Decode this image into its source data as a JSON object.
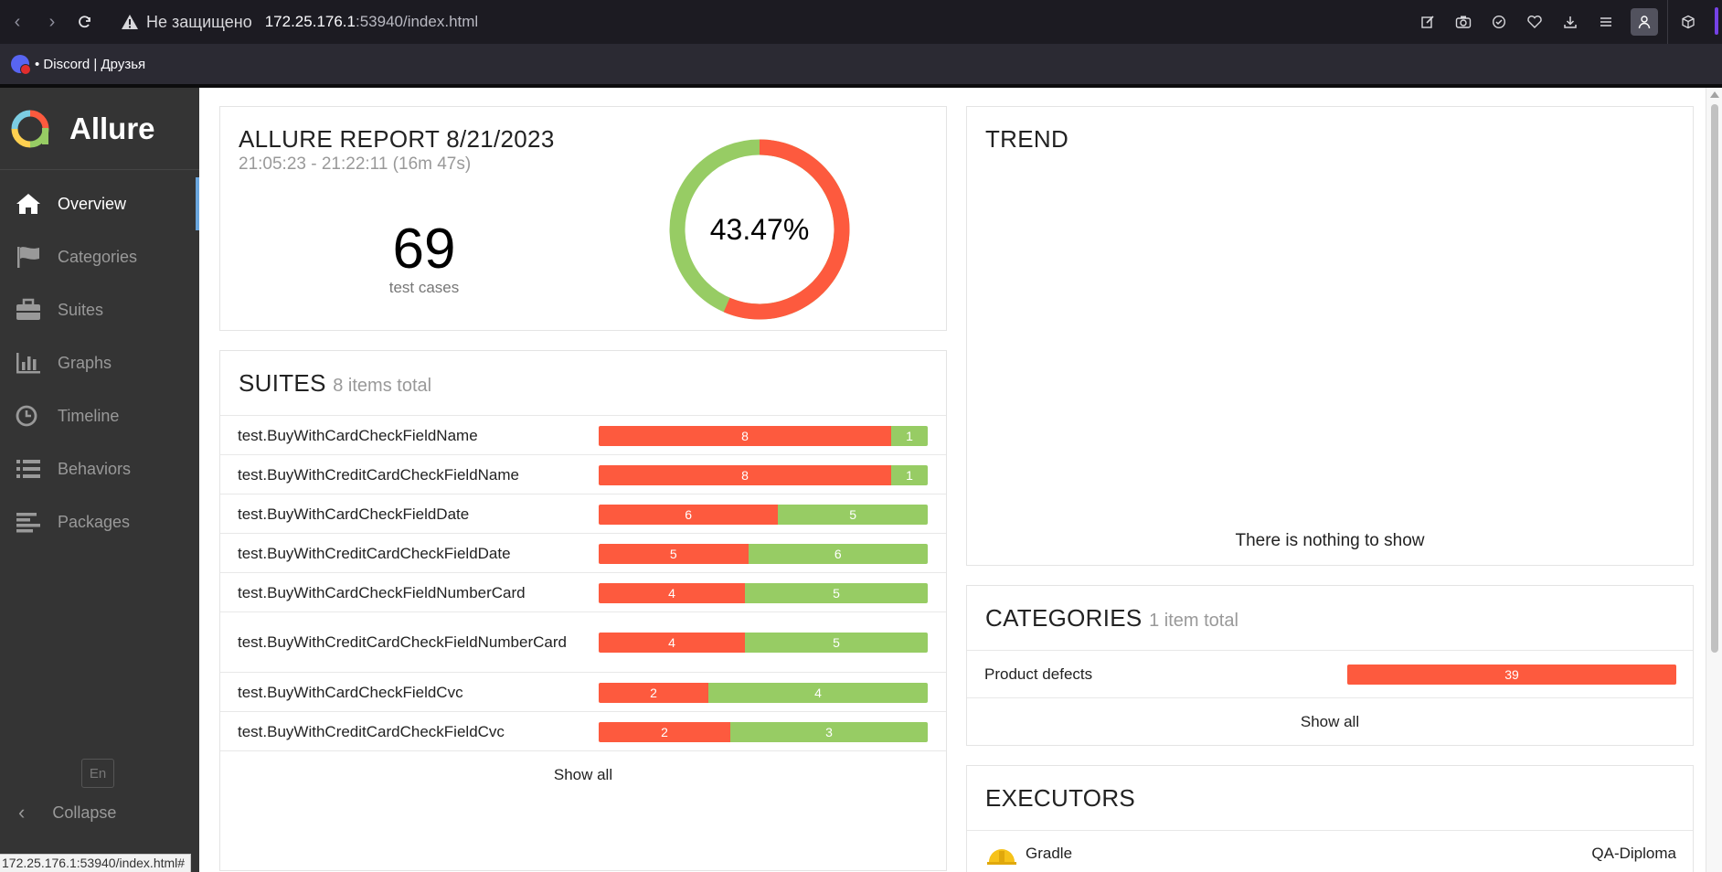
{
  "browser": {
    "insecure_label": "Не защищено",
    "url_host": "172.25.176.1",
    "url_rest": ":53940/index.html",
    "bookmark_label": "• Discord | Друзья"
  },
  "sidebar": {
    "brand": "Allure",
    "items": [
      {
        "label": "Overview",
        "icon": "home-icon"
      },
      {
        "label": "Categories",
        "icon": "flag-icon"
      },
      {
        "label": "Suites",
        "icon": "briefcase-icon"
      },
      {
        "label": "Graphs",
        "icon": "bar-chart-icon"
      },
      {
        "label": "Timeline",
        "icon": "clock-icon"
      },
      {
        "label": "Behaviors",
        "icon": "list-icon"
      },
      {
        "label": "Packages",
        "icon": "align-left-icon"
      }
    ],
    "language": "En",
    "collapse_label": "Collapse"
  },
  "summary": {
    "title": "ALLURE REPORT 8/21/2023",
    "timing": "21:05:23 - 21:22:11 (16m 47s)",
    "total": "69",
    "total_label": "test cases",
    "success_rate": "43.47%",
    "success_fraction": 0.4347
  },
  "suites": {
    "title": "SUITES",
    "subtitle": "8 items total",
    "show_all": "Show all",
    "rows": [
      {
        "name": "test.BuyWithCardCheckFieldName",
        "failed": 8,
        "passed": 1
      },
      {
        "name": "test.BuyWithCreditCardCheckFieldName",
        "failed": 8,
        "passed": 1
      },
      {
        "name": "test.BuyWithCardCheckFieldDate",
        "failed": 6,
        "passed": 5
      },
      {
        "name": "test.BuyWithCreditCardCheckFieldDate",
        "failed": 5,
        "passed": 6
      },
      {
        "name": "test.BuyWithCardCheckFieldNumberCard",
        "failed": 4,
        "passed": 5
      },
      {
        "name": "test.BuyWithCreditCardCheckFieldNumberCard",
        "failed": 4,
        "passed": 5
      },
      {
        "name": "test.BuyWithCardCheckFieldCvc",
        "failed": 2,
        "passed": 4
      },
      {
        "name": "test.BuyWithCreditCardCheckFieldCvc",
        "failed": 2,
        "passed": 3
      }
    ]
  },
  "trend": {
    "title": "TREND",
    "empty_text": "There is nothing to show"
  },
  "categories": {
    "title": "CATEGORIES",
    "subtitle": "1 item total",
    "show_all": "Show all",
    "rows": [
      {
        "name": "Product defects",
        "count": 39
      }
    ]
  },
  "executors": {
    "title": "EXECUTORS",
    "rows": [
      {
        "name": "Gradle",
        "report": "QA-Diploma",
        "icon": "gradle-helmet-icon"
      }
    ]
  },
  "status_bar": {
    "url": "172.25.176.1:53940/index.html#"
  },
  "colors": {
    "failed": "#fd5a3e",
    "passed": "#97cc64",
    "sidebar_bg": "#343434",
    "accent": "#6aa6de"
  }
}
